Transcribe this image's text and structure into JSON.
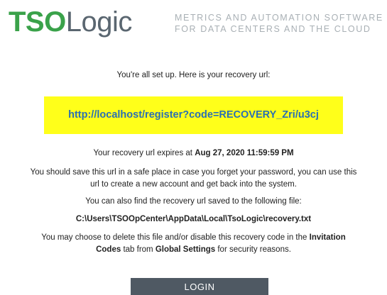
{
  "header": {
    "logo_tso": "TSO",
    "logo_logic": "Logic",
    "tagline_line1": "METRICS AND AUTOMATION SOFTWARE",
    "tagline_line2": "FOR DATA CENTERS AND THE CLOUD"
  },
  "main": {
    "intro": "You're all set up. Here is your recovery url:",
    "recovery_url": "http://localhost/register?code=RECOVERY_Zri/u3cj",
    "expires_prefix": "Your recovery url expires at ",
    "expires_date": "Aug 27, 2020 11:59:59 PM",
    "save_text": "You should save this url in a safe place in case you forget your password, you can use this url to create a new account and get back into the system.",
    "find_text": "You can also find the recovery url saved to the following file:",
    "file_path": "C:\\Users\\TSOOpCenter\\AppData\\Local\\TsoLogic\\recovery.txt",
    "delete_prefix": "You may choose to delete this file and/or disable this recovery code in the ",
    "invitation_codes": "Invitation Codes",
    "delete_middle": " tab from ",
    "global_settings": "Global Settings",
    "delete_suffix": " for security reasons."
  },
  "login_button": "LOGIN",
  "colors": {
    "brand_green": "#3aa24a",
    "brand_gray": "#5a6670",
    "highlight_yellow": "#ffff1a",
    "link_blue": "#2a6fb3",
    "button_bg": "#4f5963"
  }
}
